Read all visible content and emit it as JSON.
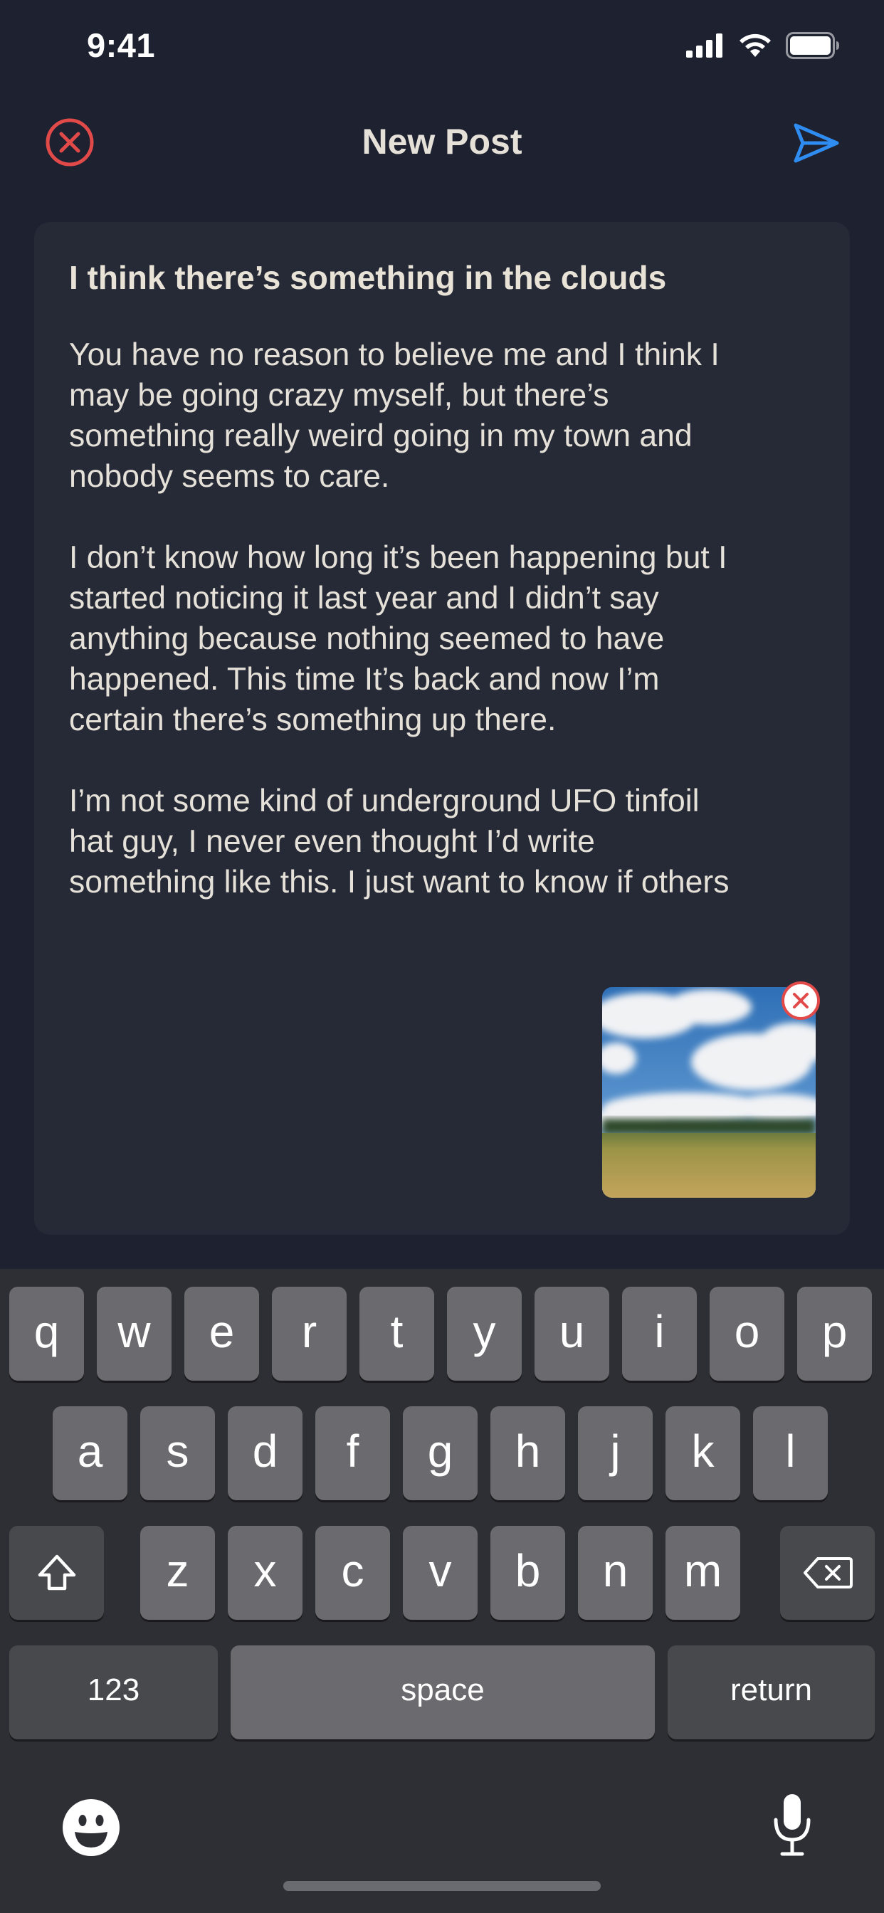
{
  "status_bar": {
    "time": "9:41"
  },
  "header": {
    "title": "New Post"
  },
  "post": {
    "title": "I think there’s something in the clouds",
    "paragraphs": [
      "You have no reason to believe me and I think I\nmay be going crazy myself, but there’s\nsomething really weird going in my town and\nnobody seems to care.",
      "I don’t know how long it’s been happening but I\nstarted noticing it last year and I didn’t say\nanything because nothing seemed to have\nhappened. This time It’s back and now I’m\ncertain there’s something up there.",
      "I’m not some kind of underground UFO tinfoil\nhat guy, I never even thought I’d write\nsomething like this. I just want to know if others"
    ]
  },
  "keyboard": {
    "row1": [
      "q",
      "w",
      "e",
      "r",
      "t",
      "y",
      "u",
      "i",
      "o",
      "p"
    ],
    "row2": [
      "a",
      "s",
      "d",
      "f",
      "g",
      "h",
      "j",
      "k",
      "l"
    ],
    "row3": [
      "z",
      "x",
      "c",
      "v",
      "b",
      "n",
      "m"
    ],
    "numbers_label": "123",
    "space_label": "space",
    "return_label": "return"
  },
  "colors": {
    "background": "#1e2130",
    "card": "#262a37",
    "close_red": "#e24a4a",
    "send_blue": "#2f8cf0",
    "text": "#e5e1d8",
    "keyboard_bg": "#2d2f35",
    "key": "#6b6b6f",
    "key_dark": "#48494d"
  },
  "icons": {
    "close": "close-circle-icon",
    "send": "send-icon",
    "remove_attachment": "remove-circle-icon",
    "shift": "shift-icon",
    "delete": "backspace-icon",
    "emoji": "emoji-icon",
    "dictation": "microphone-icon",
    "signal": "signal-icon",
    "wifi": "wifi-icon",
    "battery": "battery-icon"
  }
}
